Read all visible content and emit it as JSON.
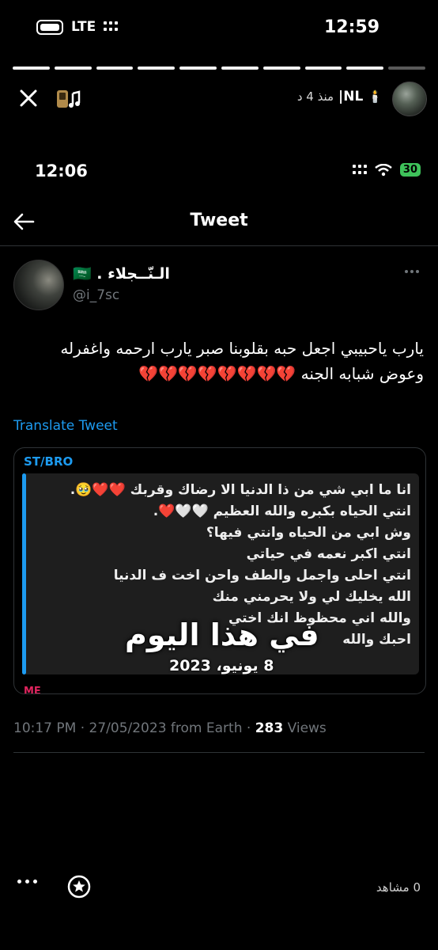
{
  "status_bar": {
    "time": "12:59",
    "network": "LTE"
  },
  "story": {
    "progress_segments": [
      true,
      true,
      true,
      true,
      true,
      true,
      true,
      true,
      true,
      false
    ],
    "username": "NL|",
    "time_ago": "منذ 4 د",
    "views": "0 مشاهد"
  },
  "screenshot": {
    "time": "12:06",
    "battery": "30",
    "nav_title": "Tweet",
    "author_name": "الـنّــجلاء .",
    "author_flag": "🇸🇦",
    "author_handle": "@i_7sc",
    "tweet_text_1": "يارب ياحبيبي اجعل حبه بقلوبنا صبر يارب ارحمه واغفرله",
    "tweet_text_2": "وعوض شبابه الجنه 💔💔💔💔💔💔💔💔",
    "translate_label": "Translate Tweet",
    "quote_author": "ST/BRO",
    "quote_lines": [
      "انا ما ابي شي من ذا الدنيا الا رضاك وقربك ❤️❤️🥹.",
      "انتي الحياه بكبره والله العظيم 🤍🤍❤️.",
      "وش ابي من الحياه وانتي فيها؟",
      "انتي اكبر نعمه في حياتي",
      "انتي احلى واجمل والطف واحن اخت ف الدنيا",
      "الله يخليك لي ولا يحرمني منك",
      "والله اني محظوظ انك اختي",
      "احبك والله"
    ],
    "overlay_title": "في هذا اليوم",
    "overlay_date": "8 يونيو، 2023",
    "quote_footer": "ME",
    "meta_time": "10:17 PM · 27/05/2023 from Earth · ",
    "meta_views": "283",
    "meta_views_label": " Views"
  }
}
